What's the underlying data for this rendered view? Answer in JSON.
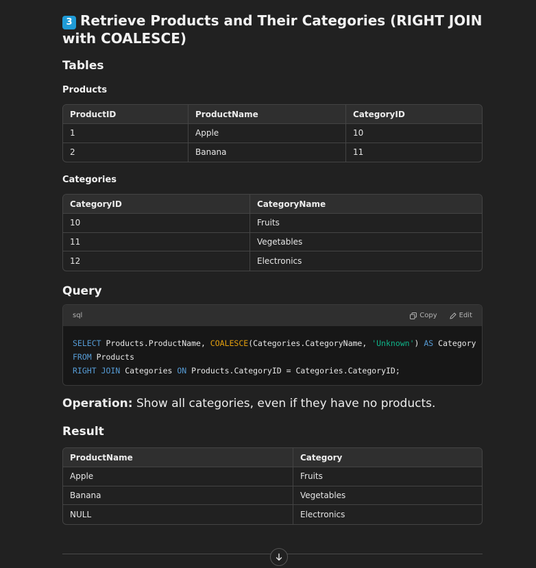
{
  "heading": {
    "number_badge": "3",
    "title": "Retrieve Products and Their Categories (RIGHT JOIN with COALESCE)"
  },
  "tables_heading": "Tables",
  "products": {
    "label": "Products",
    "columns": [
      "ProductID",
      "ProductName",
      "CategoryID"
    ],
    "rows": [
      [
        "1",
        "Apple",
        "10"
      ],
      [
        "2",
        "Banana",
        "11"
      ]
    ]
  },
  "categories": {
    "label": "Categories",
    "columns": [
      "CategoryID",
      "CategoryName"
    ],
    "rows": [
      [
        "10",
        "Fruits"
      ],
      [
        "11",
        "Vegetables"
      ],
      [
        "12",
        "Electronics"
      ]
    ]
  },
  "query_heading": "Query",
  "code_block": {
    "language": "sql",
    "copy_label": "Copy",
    "edit_label": "Edit",
    "lines": [
      "SELECT Products.ProductName, COALESCE(Categories.CategoryName, 'Unknown') AS Category",
      "FROM Products",
      "RIGHT JOIN Categories ON Products.CategoryID = Categories.CategoryID;"
    ]
  },
  "operation": {
    "label": "Operation:",
    "text": "Show all categories, even if they have no products."
  },
  "result": {
    "label": "Result",
    "columns": [
      "ProductName",
      "Category"
    ],
    "rows": [
      [
        "Apple",
        "Fruits"
      ],
      [
        "Banana",
        "Vegetables"
      ],
      [
        "NULL",
        "Electronics"
      ]
    ]
  },
  "colors": {
    "background": "#212121",
    "badge": "#1f9bd7",
    "sql_keyword": "#569cd6",
    "sql_function": "#e5a00d",
    "sql_string": "#0fb58a"
  },
  "icons": [
    "copy-icon",
    "edit-icon",
    "arrow-down-icon"
  ]
}
